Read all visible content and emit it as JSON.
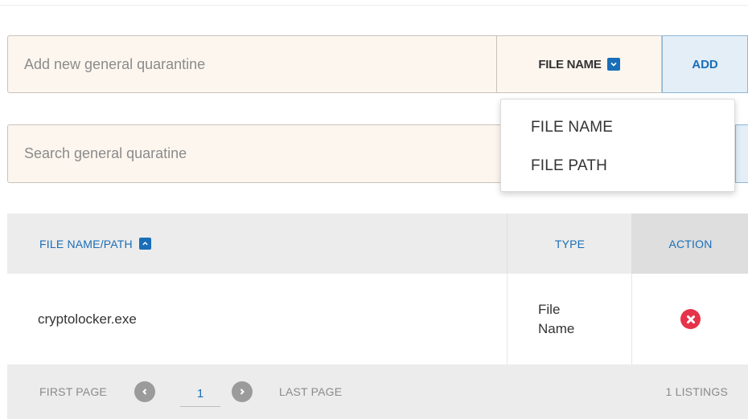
{
  "add_form": {
    "placeholder": "Add new general quarantine",
    "type_selected": "FILE NAME",
    "add_label": "ADD"
  },
  "search": {
    "placeholder": "Search general quaratine"
  },
  "type_dropdown": {
    "options": [
      "FILE NAME",
      "FILE PATH"
    ]
  },
  "table": {
    "headers": {
      "file": "FILE NAME/PATH",
      "type": "TYPE",
      "action": "ACTION"
    },
    "rows": [
      {
        "file": "cryptolocker.exe",
        "type": "File Name"
      }
    ]
  },
  "pagination": {
    "first_label": "FIRST PAGE",
    "current_page": "1",
    "last_label": "LAST PAGE",
    "listings": "1 LISTINGS"
  },
  "colors": {
    "accent": "#1a6eb8",
    "input_bg": "#fdf6ef",
    "delete": "#e5344a",
    "table_header_bg": "#ececec"
  },
  "icons": {
    "type_select": "chevron-down-icon",
    "sort": "chevron-up-icon",
    "delete": "close-icon",
    "prev": "chevron-left-icon",
    "next": "chevron-right-icon"
  }
}
